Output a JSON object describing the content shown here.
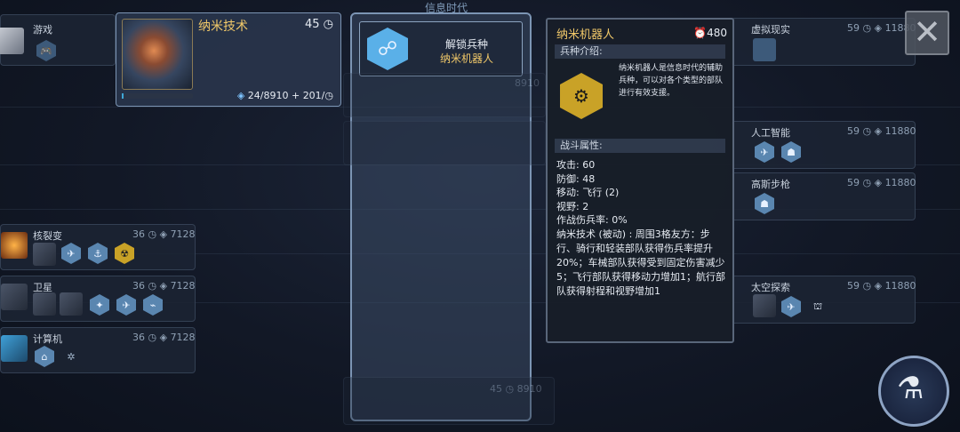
{
  "header": {
    "era": "信息时代"
  },
  "selected_tech": {
    "name": "纳米技术",
    "cost": "45",
    "progress": "24/8910 + 201/",
    "progress_fraction": 0.003
  },
  "unlock_panel": {
    "title": "解锁兵种",
    "unit": "纳米机器人"
  },
  "unit_tooltip": {
    "name": "纳米机器人",
    "cost": "480",
    "intro_header": "兵种介绍:",
    "description": "纳米机器人是信息时代的辅助兵种，可以对各个类型的部队进行有效支援。",
    "stats_header": "战斗属性:",
    "stats": [
      "攻击: 60",
      "防御: 48",
      "移动: 飞行 (2)",
      "视野: 2",
      "作战伤兵率: 0%"
    ],
    "ability": "纳米技术 (被动) : 周围3格友方：步行、骑行和轻装部队获得伤兵率提升20%；车械部队获得受到固定伤害减少5；飞行部队获得移动力增加1；航行部队获得射程和视野增加1"
  },
  "left_nodes": [
    {
      "name": "游戏",
      "turns": "",
      "science": ""
    },
    {
      "name": "核裂变",
      "turns": "36",
      "science": "7128"
    },
    {
      "name": "卫星",
      "turns": "36",
      "science": "7128"
    },
    {
      "name": "计算机",
      "turns": "36",
      "science": "7128"
    }
  ],
  "right_nodes": [
    {
      "name": "虚拟现实",
      "turns": "59",
      "science": "11880"
    },
    {
      "name": "人工智能",
      "turns": "59",
      "science": "11880"
    },
    {
      "name": "高斯步枪",
      "turns": "59",
      "science": "11880"
    },
    {
      "name": "太空探索",
      "turns": "59",
      "science": "11880"
    }
  ],
  "mid_faded": [
    {
      "name": "",
      "turns": "",
      "science": "8910"
    },
    {
      "name": "",
      "turns": "",
      "science": ""
    },
    {
      "name": "",
      "turns": "45",
      "science": "8910"
    }
  ],
  "icons": {
    "close": "close-icon",
    "science": "flask-icon",
    "turn": "clock-icon",
    "beaker": "beaker-icon"
  }
}
